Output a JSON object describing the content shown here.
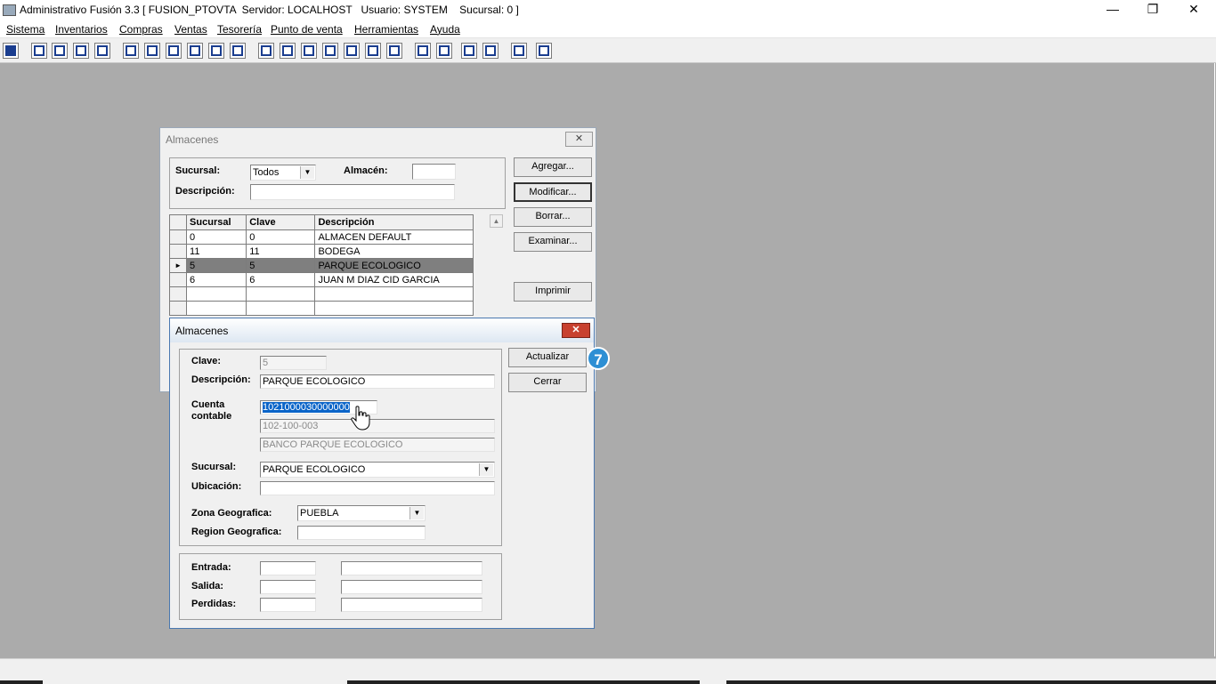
{
  "window": {
    "title": "Administrativo Fusión 3.3 [ FUSION_PTOVTA  Servidor: LOCALHOST   Usuario: SYSTEM    Sucursal: 0 ]",
    "min_glyph": "—",
    "max_glyph": "❐",
    "close_glyph": "✕"
  },
  "menu": [
    "Sistema",
    "Inventarios",
    "Compras",
    "Ventas",
    "Tesorería",
    "Punto de venta",
    "Herramientas",
    "Ayuda"
  ],
  "almacenes_list": {
    "title": "Almacenes",
    "close_glyph": "✕",
    "sucursal_label": "Sucursal:",
    "sucursal_value": "Todos",
    "almacen_label": "Almacén:",
    "almacen_value": "",
    "descripcion_label": "Descripción:",
    "descripcion_value": "",
    "buttons": {
      "agregar": "Agregar...",
      "modificar": "Modificar...",
      "borrar": "Borrar...",
      "examinar": "Examinar...",
      "imprimir": "Imprimir"
    },
    "columns": [
      "Sucursal",
      "Clave",
      "Descripción"
    ],
    "rows": [
      {
        "sucursal": "0",
        "clave": "0",
        "descripcion": "ALMACEN DEFAULT"
      },
      {
        "sucursal": "11",
        "clave": "11",
        "descripcion": "BODEGA"
      },
      {
        "sucursal": "5",
        "clave": "5",
        "descripcion": "PARQUE ECOLOGICO"
      },
      {
        "sucursal": "6",
        "clave": "6",
        "descripcion": "JUAN M DIAZ CID GARCIA"
      }
    ],
    "selected_row_marker": "►"
  },
  "almacen_edit": {
    "title": "Almacenes",
    "close_glyph": "✕",
    "clave_label": "Clave:",
    "clave_value": "5",
    "descripcion_label": "Descripción:",
    "descripcion_value": "PARQUE ECOLOGICO",
    "cuenta_label_1": "Cuenta",
    "cuenta_label_2": "contable",
    "cuenta_value": "1021000030000000",
    "cuenta_formatted": "102-100-003",
    "cuenta_nombre": "BANCO PARQUE ECOLOGICO",
    "sucursal_label": "Sucursal:",
    "sucursal_value": "PARQUE ECOLOGICO",
    "ubicacion_label": "Ubicación:",
    "ubicacion_value": "",
    "zona_label": "Zona Geografica:",
    "zona_value": "PUEBLA",
    "region_label": "Region Geografica:",
    "region_value": "",
    "entrada_label": "Entrada:",
    "salida_label": "Salida:",
    "perdidas_label": "Perdidas:",
    "actualizar_label": "Actualizar",
    "cerrar_label": "Cerrar"
  },
  "step_badge": "7",
  "colors": {
    "mdi_background": "#ababab",
    "selection": "#0a64c8",
    "badge": "#2d8fd4",
    "close_red": "#c8412f"
  },
  "icons": [
    "app-icon",
    "new-icon",
    "open-icon",
    "transfer-icon",
    "search-icon",
    "user-icon",
    "folder-icon",
    "print-icon",
    "document-icon",
    "list-icon",
    "group-icon",
    "box-icon",
    "export-icon",
    "add-icon",
    "dollar-icon",
    "home-icon",
    "zoom-icon",
    "refresh-icon",
    "undo-icon",
    "back-icon",
    "help-icon"
  ]
}
